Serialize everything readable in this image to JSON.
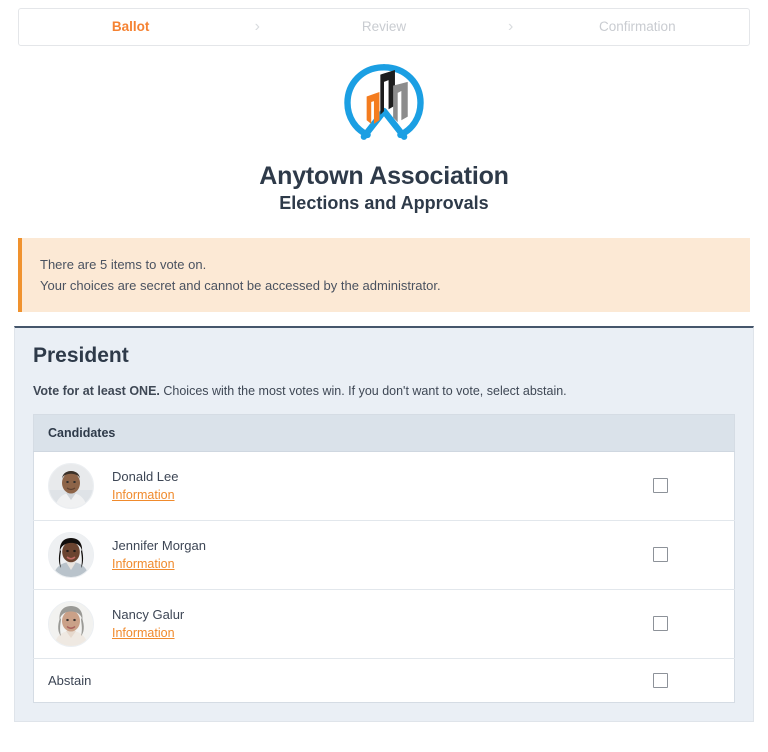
{
  "steps": {
    "items": [
      {
        "label": "Ballot",
        "state": "active"
      },
      {
        "label": "Review",
        "state": "inactive"
      },
      {
        "label": "Confirmation",
        "state": "inactive"
      }
    ],
    "separator": "›"
  },
  "brand": {
    "logo_name": "anytown-association-logo",
    "title": "Anytown Association",
    "subtitle": "Elections and Approvals"
  },
  "alert": {
    "line1": "There are 5 items to vote on.",
    "line2": "Your choices are secret and cannot be accessed by the administrator."
  },
  "contest": {
    "title": "President",
    "instructions_bold": "Vote for at least ONE.",
    "instructions_rest": " Choices with the most votes win. If you don't want to vote, select abstain.",
    "column_header": "Candidates",
    "candidates": [
      {
        "name": "Donald Lee",
        "info_label": "Information",
        "checked": false,
        "avatar": "donald-lee-photo"
      },
      {
        "name": "Jennifer Morgan",
        "info_label": "Information",
        "checked": false,
        "avatar": "jennifer-morgan-photo"
      },
      {
        "name": "Nancy Galur",
        "info_label": "Information",
        "checked": false,
        "avatar": "nancy-galur-photo"
      }
    ],
    "abstain_label": "Abstain",
    "abstain_checked": false
  },
  "colors": {
    "accent_orange": "#f58232",
    "link_orange": "#f08a2c",
    "alert_bg": "#fce9d5",
    "alert_border": "#f0922e",
    "section_bg": "#eaeff5",
    "section_top_border": "#45566b",
    "table_header_bg": "#dae2ea",
    "logo_blue": "#1b9fe3",
    "text_dark": "#2e3a49",
    "inactive_gray": "#c9ccd1"
  }
}
